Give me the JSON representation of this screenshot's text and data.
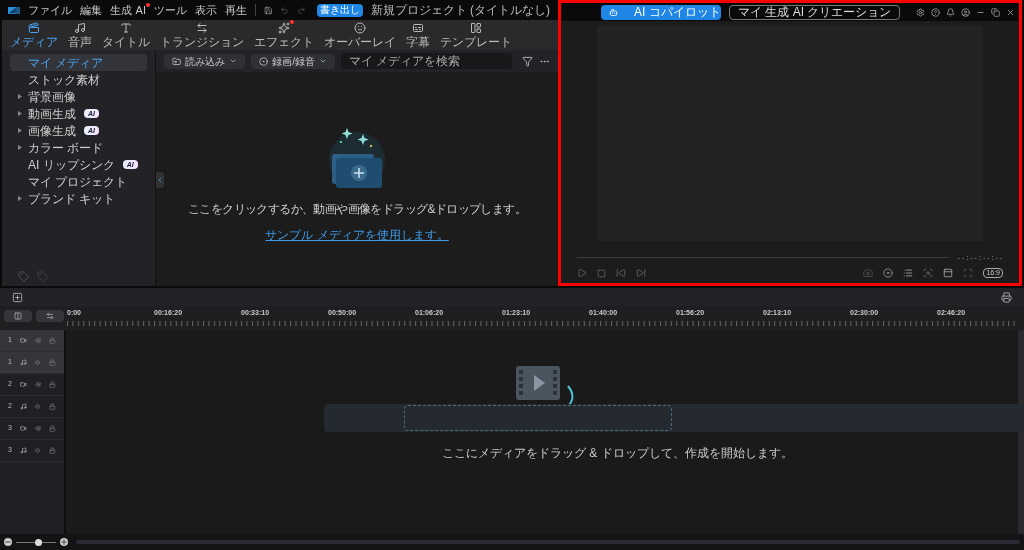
{
  "menu": [
    {
      "label": "ファイル",
      "notify": false
    },
    {
      "label": "編集",
      "notify": false
    },
    {
      "label": "生成 AI",
      "notify": true
    },
    {
      "label": "ツール",
      "notify": false
    },
    {
      "label": "表示",
      "notify": false
    },
    {
      "label": "再生",
      "notify": false
    }
  ],
  "export_button": "書き出し",
  "project_title": "新規プロジェクト (タイトルなし)",
  "tabs": [
    {
      "label": "メディア",
      "selected": true,
      "notify": false
    },
    {
      "label": "音声",
      "selected": false,
      "notify": false
    },
    {
      "label": "タイトル",
      "selected": false,
      "notify": false
    },
    {
      "label": "トランジション",
      "selected": false,
      "notify": false
    },
    {
      "label": "エフェクト",
      "selected": false,
      "notify": true
    },
    {
      "label": "オーバーレイ",
      "selected": false,
      "notify": false
    },
    {
      "label": "字幕",
      "selected": false,
      "notify": false
    },
    {
      "label": "テンプレート",
      "selected": false,
      "notify": false
    }
  ],
  "sidebar": {
    "items": [
      {
        "label": "マイ メディア",
        "selected": true,
        "expandable": false
      },
      {
        "label": "ストック素材",
        "selected": false,
        "expandable": false
      },
      {
        "label": "背景画像",
        "selected": false,
        "expandable": true
      },
      {
        "label": "動画生成",
        "selected": false,
        "expandable": true,
        "badge": "AI"
      },
      {
        "label": "画像生成",
        "selected": false,
        "expandable": true,
        "badge": "AI"
      },
      {
        "label": "カラー ボード",
        "selected": false,
        "expandable": true
      },
      {
        "label": "AI リップシンク",
        "selected": false,
        "expandable": false,
        "badge": "AI"
      },
      {
        "label": "マイ プロジェクト",
        "selected": false,
        "expandable": false
      },
      {
        "label": "ブランド キット",
        "selected": false,
        "expandable": true
      }
    ]
  },
  "media": {
    "import_button": "読み込み",
    "record_button": "録画/録音",
    "search": {
      "placeholder": "マイ メディアを検索"
    },
    "empty_text": "ここをクリックするか、動画や画像をドラッグ&ドロップします。",
    "sample_link": "サンプル メディアを使用します。"
  },
  "preview": {
    "copilot_button": "AI コパイロット",
    "creations_button": "マイ 生成 AI クリエーション",
    "timecode": "--:--:--:--",
    "aspect": "16:9",
    "highlighted": true
  },
  "timeline": {
    "ruler": [
      "0:00",
      "00:16:20",
      "00:33:10",
      "00:50:00",
      "01:06:20",
      "01:23:10",
      "01:40:00",
      "01:56:20",
      "02:13:10",
      "02:30:00",
      "02:46:20"
    ],
    "tracks": [
      {
        "number": "1",
        "kind": "video",
        "selected": true
      },
      {
        "number": "1",
        "kind": "audio",
        "selected": true
      },
      {
        "number": "2",
        "kind": "video",
        "selected": false
      },
      {
        "number": "2",
        "kind": "audio",
        "selected": false
      },
      {
        "number": "3",
        "kind": "video",
        "selected": false
      },
      {
        "number": "3",
        "kind": "audio",
        "selected": false
      }
    ],
    "empty_text": "ここにメディアをドラッグ & ドロップして、作成を開始します。",
    "zoom": {
      "level": 0.55
    }
  }
}
